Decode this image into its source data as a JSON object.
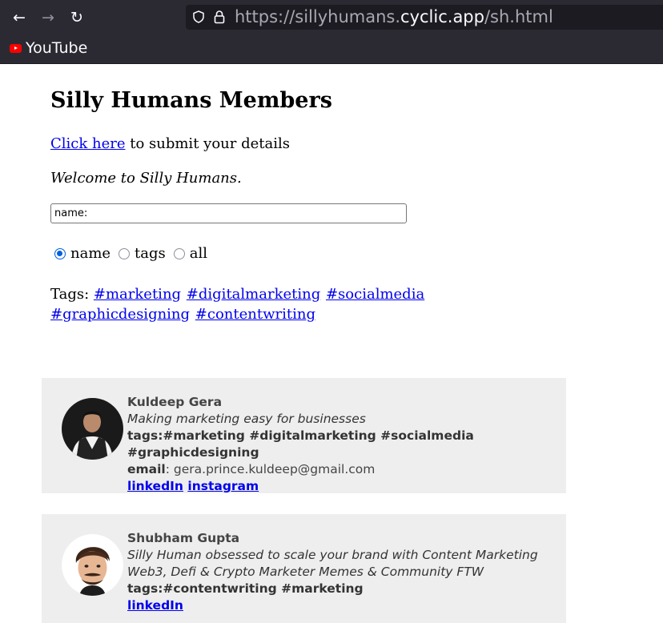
{
  "browser": {
    "url_scheme": "https://sillyhumans.",
    "url_host": "cyclic.app",
    "url_path": "/sh.html",
    "bookmark_label": "YouTube"
  },
  "page": {
    "title": "Silly Humans Members",
    "submit_link": "Click here",
    "submit_text": " to submit your details",
    "welcome": "Welcome to Silly Humans.",
    "search_placeholder": "name:",
    "radio_options": [
      "name",
      "tags",
      "all"
    ],
    "radio_selected": "name",
    "tags_label": "Tags:",
    "tags": [
      "#marketing",
      "#digitalmarketing",
      "#socialmedia",
      "#graphicdesigning",
      "#contentwriting"
    ]
  },
  "members": [
    {
      "name": "Kuldeep Gera",
      "bio": "Making marketing easy for businesses",
      "tags": "tags:#marketing #digitalmarketing #socialmedia #graphicdesigning",
      "email_label": "email",
      "email": ": gera.prince.kuldeep@gmail.com",
      "links": [
        "linkedIn",
        "instagram"
      ]
    },
    {
      "name": "Shubham Gupta",
      "bio": "Silly Human obsessed to scale your brand with Content Marketing Web3, Defi & Crypto Marketer Memes & Community FTW",
      "tags": "tags:#contentwriting #marketing",
      "links": [
        "linkedIn"
      ]
    }
  ]
}
